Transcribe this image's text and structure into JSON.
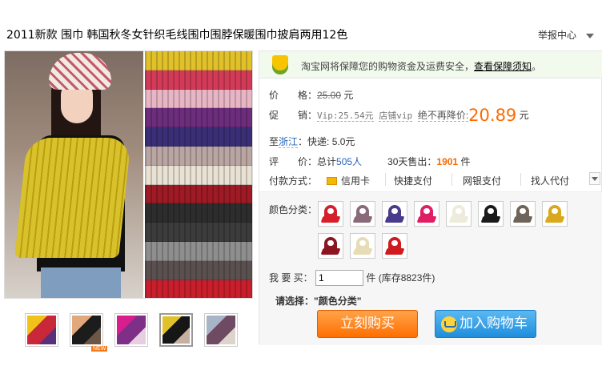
{
  "product": {
    "title": "2011新款 围巾 韩国秋冬女针织毛线围巾围脖保暖围巾披肩两用12色"
  },
  "header": {
    "report_label": "举报中心"
  },
  "gallery": {
    "knit_colors": [
      "#e1c12a",
      "#d23a57",
      "#e8b5c5",
      "#6d2d7d",
      "#3a2f77",
      "#b9a5a2",
      "#e9e1d3",
      "#9e1a24",
      "#2d2d2d",
      "#3c3c3c",
      "#8e8e8e",
      "#5b5050",
      "#c91f2c"
    ],
    "thumbs": [
      {
        "colors": [
          "#f1c21a",
          "#c9283a",
          "#5a2f7c"
        ]
      },
      {
        "colors": [
          "#e1a87e",
          "#1c1c1c",
          "#6c5645"
        ],
        "tag": "NEW"
      },
      {
        "colors": [
          "#d81d8c",
          "#7e2f88",
          "#e6cfe0"
        ]
      },
      {
        "colors": [
          "#e1c12a",
          "#161616",
          "#c7b0a1"
        ]
      },
      {
        "colors": [
          "#a8b5c7",
          "#6f4a63",
          "#ddd4cc"
        ]
      }
    ]
  },
  "security": {
    "text": "淘宝网将保障您的购物资金及运费安全，",
    "link": "查看保障须知",
    "link_suffix": "。"
  },
  "price": {
    "label": "价　　格：",
    "original": "25.00",
    "unit": "元"
  },
  "promo": {
    "label": "促　　销：",
    "vip": "Vip:25.54元",
    "store_vip": "店铺vip",
    "no_drop": "绝不再降价:",
    "value": "20.89",
    "unit": "元"
  },
  "shipping": {
    "to": "至",
    "region": "浙江",
    "method": "：快递: 5.0元"
  },
  "review": {
    "label": "评　　价：",
    "total_prefix": "总计",
    "total_count": "505人",
    "sold_label": "30天售出：",
    "sold_count": "1901",
    "sold_unit": "件"
  },
  "payment": {
    "label": "付款方式：",
    "options": [
      "信用卡",
      "快捷支付",
      "网银支付",
      "找人代付"
    ]
  },
  "options": {
    "color_label": "颜色分类：",
    "swatch_colors": [
      "#d71f2b",
      "#8a6a78",
      "#4a3a8c",
      "#e01e63",
      "#ecebdc",
      "#1b1b1b",
      "#6f645a",
      "#d9a81c",
      "#8c1620",
      "#e7dcb6",
      "#cf1b1f"
    ]
  },
  "purchase": {
    "qty_label": "我 要 买：",
    "qty_value": "1",
    "stock": "件 (库存8823件)",
    "prompt": "请选择：\"颜色分类\"",
    "buy_now": "立刻购买",
    "add_cart": "加入购物车"
  }
}
